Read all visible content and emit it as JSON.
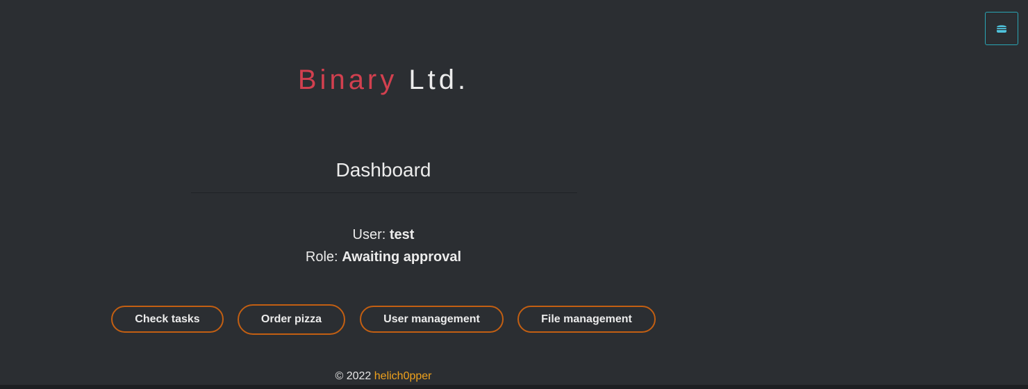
{
  "menu": {
    "icon": "hamburger-icon",
    "icon_color": "#4fc3dc",
    "border_color": "#2aa6b5"
  },
  "brand": {
    "accent_text": "Binary",
    "rest_text": "Ltd.",
    "accent_color": "#d2404f"
  },
  "page": {
    "title": "Dashboard"
  },
  "user_info": {
    "user_label": "User:",
    "user_value": "test",
    "role_label": "Role:",
    "role_value": "Awaiting approval"
  },
  "actions": {
    "check_tasks": "Check tasks",
    "order_pizza": "Order pizza",
    "user_management": "User management",
    "file_management": "File management",
    "border_color": "#c35f12"
  },
  "footer": {
    "copyright": "© 2022",
    "author": "helich0pper",
    "author_color": "#f0a21c"
  },
  "colors": {
    "background": "#2b2e32",
    "text": "#ececec"
  }
}
